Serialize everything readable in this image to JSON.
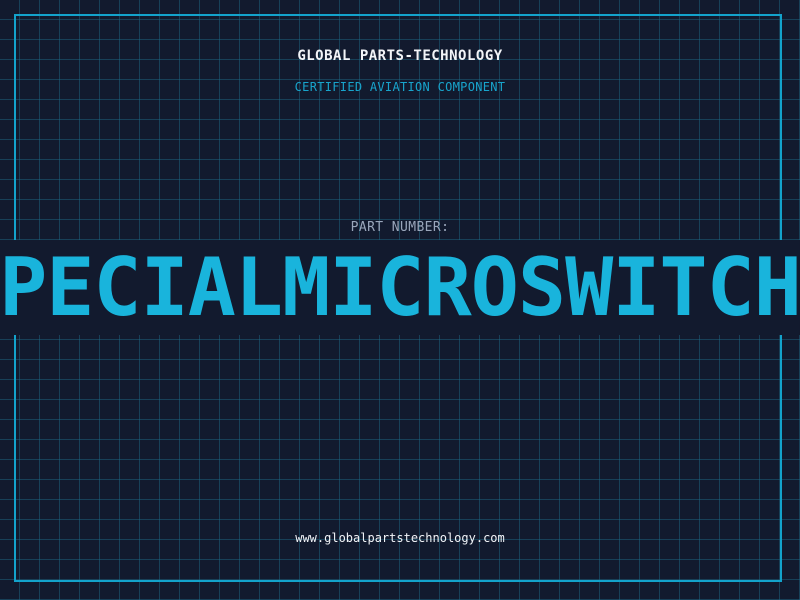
{
  "header": {
    "brand": "GLOBAL PARTS-TECHNOLOGY",
    "subtitle": "CERTIFIED AVIATION COMPONENT"
  },
  "part": {
    "label": "PART NUMBER:",
    "number": "SPECIALMICROSWITCHV"
  },
  "footer": {
    "website": "www.globalpartstechnology.com"
  },
  "colors": {
    "background": "#121a2e",
    "accent": "#19b4dc",
    "grid": "#1e6e8c",
    "text": "#f2f4f8",
    "muted": "#9aa6bb"
  }
}
